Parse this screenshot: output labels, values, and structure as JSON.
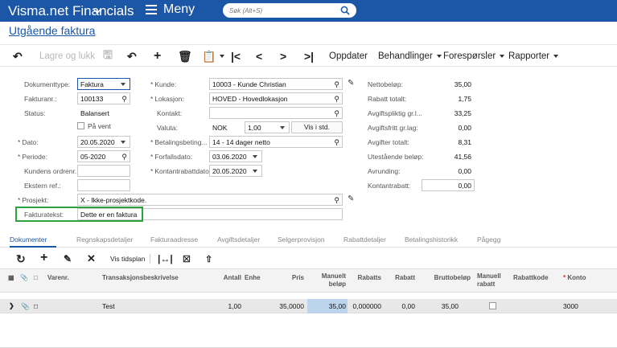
{
  "header": {
    "app_title": "Visma.net Financials",
    "menu_label": "Meny",
    "search_placeholder": "Søk (Alt+S)"
  },
  "page_title": "Utgående faktura",
  "toolbar": {
    "save_close_label": "Lagre og lukk",
    "refresh_label": "Oppdater",
    "actions_label": "Behandlinger",
    "inquiries_label": "Forespørsler",
    "reports_label": "Rapporter"
  },
  "form": {
    "doc_type": {
      "label": "Dokumenttype:",
      "value": "Faktura"
    },
    "invoice_nr": {
      "label": "Fakturanr.:",
      "value": "100133"
    },
    "status": {
      "label": "Status:",
      "value": "Balansert"
    },
    "on_hold_label": "På vent",
    "date": {
      "label": "Dato:",
      "value": "20.05.2020"
    },
    "period": {
      "label": "Periode:",
      "value": "05-2020"
    },
    "customer_order": {
      "label": "Kundens ordrenr.:",
      "value": ""
    },
    "external_ref": {
      "label": "Ekstern ref.:",
      "value": ""
    },
    "project": {
      "label": "Prosjekt:",
      "value": "X - Ikke-prosjektkode."
    },
    "invoice_text": {
      "label": "Fakturatekst:",
      "value": "Dette er en faktura"
    },
    "customer": {
      "label": "Kunde:",
      "value": "10003 - Kunde Christian"
    },
    "location": {
      "label": "Lokasjon:",
      "value": "HOVED - Hovedlokasjon"
    },
    "contact": {
      "label": "Kontakt:",
      "value": ""
    },
    "currency": {
      "label": "Valuta:",
      "code": "NOK",
      "rate": "1,00",
      "button": "Vis i std."
    },
    "payment_terms": {
      "label": "Betalingsbeting...",
      "value": "14 - 14 dager netto"
    },
    "due_date": {
      "label": "Forfallsdato:",
      "value": "03.06.2020"
    },
    "cash_discount_date": {
      "label": "Kontantrabattdato:",
      "value": "20.05.2020"
    },
    "totals": {
      "net_label": "Nettobeløp:",
      "net": "35,00",
      "discount_label": "Rabatt totalt:",
      "discount": "1,75",
      "taxable_label": "Avgiftspliktig gr.l...",
      "taxable": "33,25",
      "taxfree_label": "Avgiftsfritt gr.lag:",
      "taxfree": "0,00",
      "tax_label": "Avgifter totalt:",
      "tax": "8,31",
      "outstanding_label": "Utestående beløp:",
      "outstanding": "41,56",
      "rounding_label": "Avrunding:",
      "rounding": "0,00",
      "cash_discount_label": "Kontantrabatt:",
      "cash_discount": "0,00"
    }
  },
  "tabs": [
    "Dokumenter",
    "Regnskapsdetaljer",
    "Fakturaadresse",
    "Avgiftsdetaljer",
    "Selgerprovisjon",
    "Rabattdetaljer",
    "Betalingshistorikk",
    "Pågegg"
  ],
  "grid_toolbar": {
    "schedule_label": "Vis tidsplan"
  },
  "grid": {
    "columns": {
      "item": "Varenr.",
      "description": "Transaksjonsbeskrivelse",
      "qty": "Antall",
      "unit": "Enhe",
      "price": "Pris",
      "manual_amount": "Manuelt beløp",
      "discount_pct": "Rabatts",
      "discount": "Rabatt",
      "gross": "Bruttobeløp",
      "manual_discount": "Manuell rabatt",
      "discount_code": "Rabattkode",
      "account": "Konto"
    },
    "rows": [
      {
        "description": "Test",
        "qty": "1,00",
        "price": "35,0000",
        "manual_amount": "35,00",
        "discount_pct": "0,000000",
        "discount": "0,00",
        "gross": "35,00",
        "account": "3000"
      }
    ]
  },
  "colors": {
    "brand": "#1b57a6",
    "highlight_border": "#2aa53c"
  }
}
